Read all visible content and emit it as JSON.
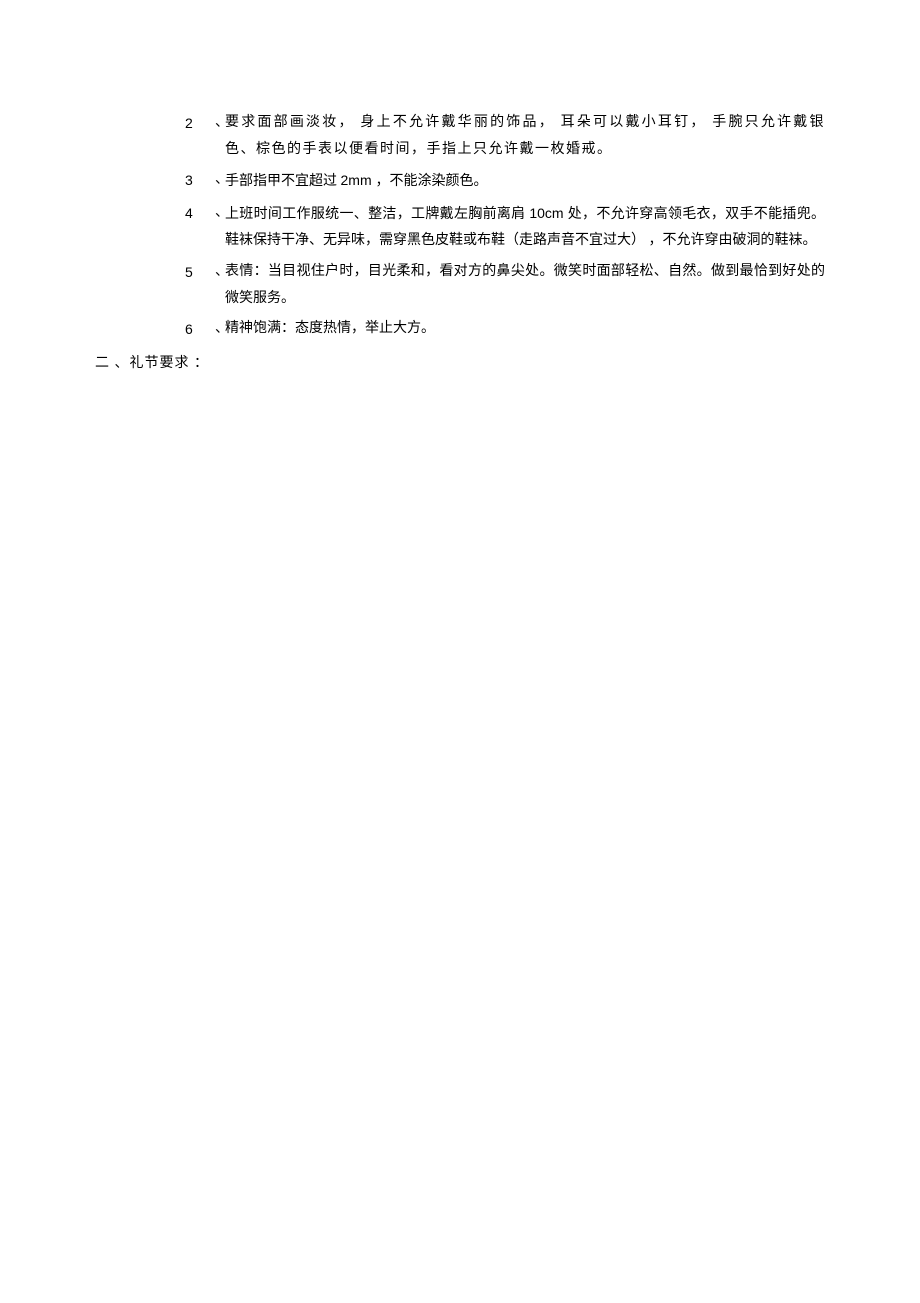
{
  "items": [
    {
      "number": "2",
      "sep": "、",
      "content": "要求面部画淡妆， 身上不允许戴华丽的饰品， 耳朵可以戴小耳钉， 手腕只允许戴银色、棕色的手表以便看时间，手指上只允许戴一枚婚戒。",
      "spread": true
    },
    {
      "number": "3",
      "sep": "、",
      "content_prefix": " 手部指甲不宜超过 ",
      "content_latin": "2mm ",
      "content_suffix": "，不能涂染颜色。"
    },
    {
      "number": "4",
      "sep": "、",
      "content_prefix": " 上班时间工作服统一、整洁，工牌戴左胸前离肩 ",
      "content_latin": "10cm ",
      "content_suffix": "处，不允许穿高领毛衣，双手不能插兜。鞋袜保持干净、无异味，需穿黑色皮鞋或布鞋（走路声音不宜过大） ，不允许穿由破洞的鞋袜。"
    },
    {
      "number": "5",
      "sep": "、",
      "content": " 表情：当目视住户时，目光柔和，看对方的鼻尖处。微笑时面部轻松、自然。做到最恰到好处的微笑服务。"
    },
    {
      "number": "6",
      "sep": "、",
      "content": " 精神饱满：态度热情，举止大方。"
    }
  ],
  "section_heading": "二  、礼节要求  ："
}
